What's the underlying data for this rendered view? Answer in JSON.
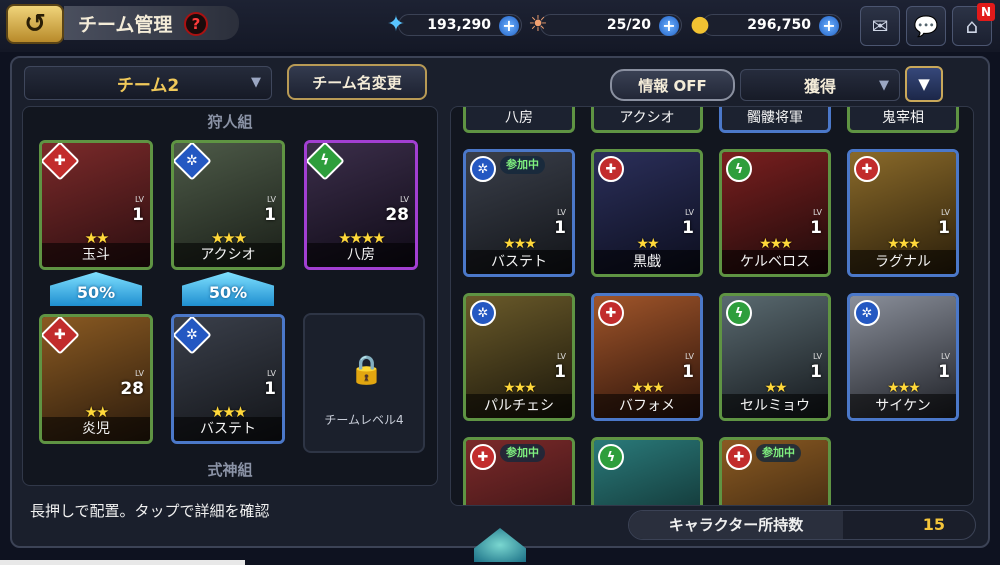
{
  "header": {
    "title": "チーム管理",
    "help_symbol": "?",
    "back_symbol": "↺"
  },
  "currencies": [
    {
      "name": "crystal",
      "icon": "crystal-icon",
      "value": "193,290"
    },
    {
      "name": "stamina",
      "icon": "stamina-icon",
      "value": "25/20"
    },
    {
      "name": "gold",
      "icon": "coin-icon",
      "value": "296,750"
    }
  ],
  "top_icons": [
    {
      "name": "mail-icon"
    },
    {
      "name": "chat-icon"
    },
    {
      "name": "home-icon",
      "badge": "N"
    }
  ],
  "team": {
    "selected": "チーム2",
    "rename_label": "チーム名変更",
    "hunter_group_label": "狩人組",
    "shikigami_group_label": "式神組",
    "hunters": [
      {
        "name": "玉斗",
        "element": "fire",
        "level": "1",
        "stars": 2,
        "rarity_color": "green"
      },
      {
        "name": "アクシオ",
        "element": "water",
        "level": "1",
        "stars": 3,
        "rarity_color": "green"
      },
      {
        "name": "八房",
        "element": "wind",
        "level": "28",
        "stars": 4,
        "rarity_color": "purple"
      }
    ],
    "bonuses": [
      "50%",
      "50%"
    ],
    "shikigami": [
      {
        "name": "炎児",
        "element": "fire",
        "level": "28",
        "stars": 2,
        "rarity_color": "green"
      },
      {
        "name": "バステト",
        "element": "water",
        "level": "1",
        "stars": 3,
        "rarity_color": "blue"
      }
    ],
    "locked_slot_text": "チームレベル4"
  },
  "filters": {
    "info_toggle": "情報 OFF",
    "sort_label": "獲得",
    "sort_order_symbol": "▼"
  },
  "roster": {
    "top_partial": [
      "八房",
      "アクシオ",
      "髑髏将軍",
      "鬼宰相"
    ],
    "row1": [
      {
        "name": "バステト",
        "element": "water",
        "level": "1",
        "stars": 3,
        "in_team": "参加中",
        "border": "blue"
      },
      {
        "name": "黒戯",
        "element": "fire",
        "level": "1",
        "stars": 2,
        "in_team": "",
        "border": "green"
      },
      {
        "name": "ケルベロス",
        "element": "wind",
        "level": "1",
        "stars": 3,
        "in_team": "",
        "border": "green"
      },
      {
        "name": "ラグナル",
        "element": "fire",
        "level": "1",
        "stars": 3,
        "in_team": "",
        "border": "blue"
      }
    ],
    "row2": [
      {
        "name": "パルチェシ",
        "element": "water",
        "level": "1",
        "stars": 3,
        "in_team": "",
        "border": "green"
      },
      {
        "name": "バフォメ",
        "element": "fire",
        "level": "1",
        "stars": 3,
        "in_team": "",
        "border": "blue"
      },
      {
        "name": "セルミョウ",
        "element": "wind",
        "level": "1",
        "stars": 2,
        "in_team": "",
        "border": "green"
      },
      {
        "name": "サイケン",
        "element": "water",
        "level": "1",
        "stars": 3,
        "in_team": "",
        "border": "blue"
      }
    ],
    "row3_badges": [
      "参加中",
      "",
      "参加中"
    ]
  },
  "footer": {
    "hint": "長押しで配置。タップで詳細を確認",
    "owned_label": "キャラクター所持数",
    "owned_count": "15"
  },
  "colors": {
    "gold_text": "#f0c95a",
    "fire": "#c22c2c",
    "water": "#2458c2",
    "wind": "#2e9e3c",
    "star": "#ffd83a"
  }
}
